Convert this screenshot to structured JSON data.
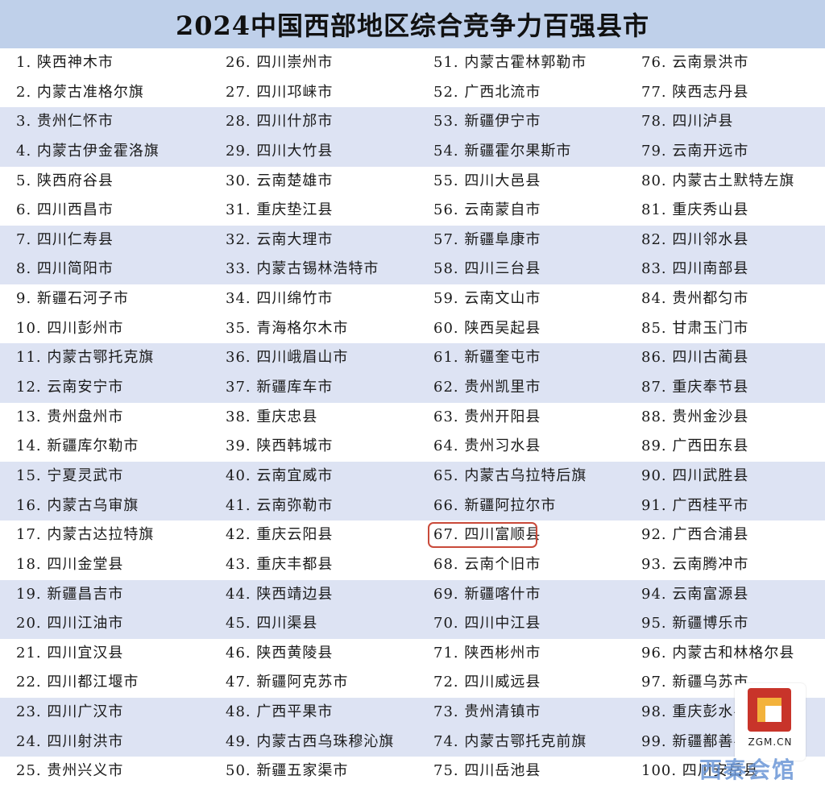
{
  "title": "2024中国西部地区综合竞争力百强县市",
  "columns": [
    [
      "1. 陕西神木市",
      "2. 内蒙古准格尔旗",
      "3. 贵州仁怀市",
      "4. 内蒙古伊金霍洛旗",
      "5. 陕西府谷县",
      "6. 四川西昌市",
      "7. 四川仁寿县",
      "8. 四川简阳市",
      "9. 新疆石河子市",
      "10. 四川彭州市",
      "11. 内蒙古鄂托克旗",
      "12. 云南安宁市",
      "13. 贵州盘州市",
      "14. 新疆库尔勒市",
      "15. 宁夏灵武市",
      "16. 内蒙古乌审旗",
      "17. 内蒙古达拉特旗",
      "18. 四川金堂县",
      "19. 新疆昌吉市",
      "20. 四川江油市",
      "21. 四川宜汉县",
      "22. 四川都江堰市",
      "23. 四川广汉市",
      "24. 四川射洪市",
      "25. 贵州兴义市"
    ],
    [
      "26. 四川崇州市",
      "27. 四川邛崃市",
      "28. 四川什邡市",
      "29. 四川大竹县",
      "30. 云南楚雄市",
      "31. 重庆垫江县",
      "32. 云南大理市",
      "33. 内蒙古锡林浩特市",
      "34. 四川绵竹市",
      "35. 青海格尔木市",
      "36. 四川峨眉山市",
      "37. 新疆库车市",
      "38. 重庆忠县",
      "39. 陕西韩城市",
      "40. 云南宜威市",
      "41. 云南弥勒市",
      "42. 重庆云阳县",
      "43. 重庆丰都县",
      "44. 陕西靖边县",
      "45. 四川渠县",
      "46. 陕西黄陵县",
      "47. 新疆阿克苏市",
      "48. 广西平果市",
      "49. 内蒙古西乌珠穆沁旗",
      "50. 新疆五家渠市"
    ],
    [
      "51. 内蒙古霍林郭勒市",
      "52. 广西北流市",
      "53. 新疆伊宁市",
      "54. 新疆霍尔果斯市",
      "55. 四川大邑县",
      "56. 云南蒙自市",
      "57. 新疆阜康市",
      "58. 四川三台县",
      "59. 云南文山市",
      "60. 陕西吴起县",
      "61. 新疆奎屯市",
      "62. 贵州凯里市",
      "63. 贵州开阳县",
      "64. 贵州习水县",
      "65. 内蒙古乌拉特后旗",
      "66. 新疆阿拉尔市",
      "67. 四川富顺县",
      "68. 云南个旧市",
      "69. 新疆喀什市",
      "70. 四川中江县",
      "71. 陕西彬州市",
      "72. 四川威远县",
      "73. 贵州清镇市",
      "74. 内蒙古鄂托克前旗",
      "75. 四川岳池县"
    ],
    [
      "76. 云南景洪市",
      "77. 陕西志丹县",
      "78. 四川泸县",
      "79. 云南开远市",
      "80. 内蒙古土默特左旗",
      "81. 重庆秀山县",
      "82. 四川邻水县",
      "83. 四川南部县",
      "84. 贵州都匀市",
      "85. 甘肃玉门市",
      "86. 四川古蔺县",
      "87. 重庆奉节县",
      "88. 贵州金沙县",
      "89. 广西田东县",
      "90. 四川武胜县",
      "91. 广西桂平市",
      "92. 广西合浦县",
      "93. 云南腾冲市",
      "94. 云南富源县",
      "95. 新疆博乐市",
      "96. 内蒙古和林格尔县",
      "97. 新疆乌苏市",
      "98. 重庆彭水县",
      "99. 新疆鄯善县",
      "100. 四川安岳县"
    ]
  ],
  "highlight": {
    "column": 2,
    "row": 16
  },
  "logo": {
    "text": "ZGM.CN"
  },
  "watermark": "西秦会馆"
}
